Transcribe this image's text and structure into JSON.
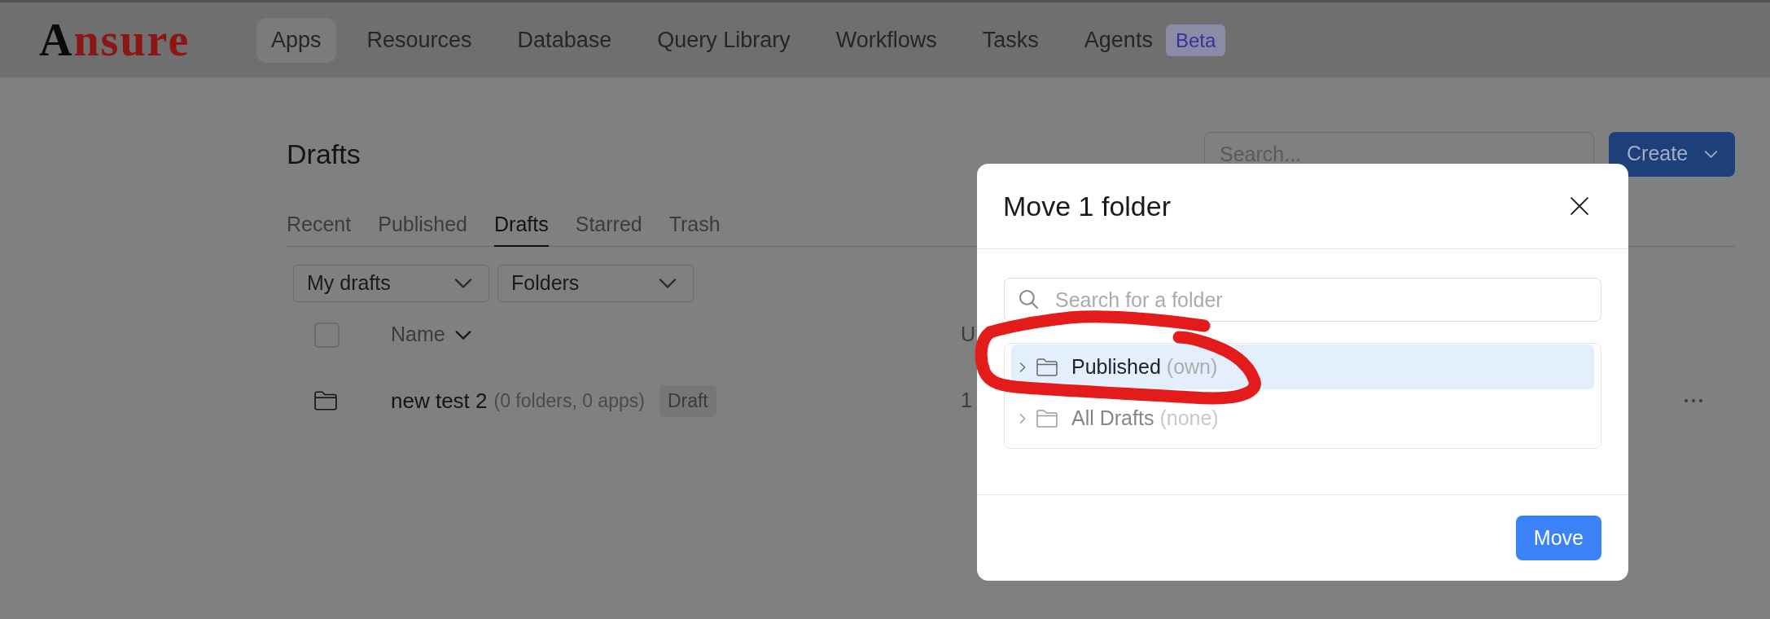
{
  "logo": {
    "initial": "A",
    "rest": "nsure"
  },
  "nav": [
    {
      "label": "Apps",
      "selected": true
    },
    {
      "label": "Resources",
      "selected": false
    },
    {
      "label": "Database",
      "selected": false
    },
    {
      "label": "Query Library",
      "selected": false
    },
    {
      "label": "Workflows",
      "selected": false
    },
    {
      "label": "Tasks",
      "selected": false
    },
    {
      "label": "Agents",
      "selected": false,
      "badge": "Beta"
    }
  ],
  "page": {
    "title": "Drafts",
    "search": {
      "placeholder": "Search..."
    },
    "create_button": "Create"
  },
  "tabs": [
    {
      "label": "Recent",
      "selected": false
    },
    {
      "label": "Published",
      "selected": false
    },
    {
      "label": "Drafts",
      "selected": true
    },
    {
      "label": "Starred",
      "selected": false
    },
    {
      "label": "Trash",
      "selected": false
    }
  ],
  "filters": [
    {
      "value": "My drafts"
    },
    {
      "value": "Folders"
    }
  ],
  "table": {
    "select_all": {
      "checked": false
    },
    "columns": [
      {
        "label": "Name"
      },
      {
        "label": "U"
      }
    ],
    "rows": [
      {
        "name": "new test 2",
        "summary": "(0 folders, 0 apps)",
        "badge": "Draft",
        "column_2": "1"
      }
    ]
  },
  "dialog": {
    "title": "Move 1 folder",
    "search": {
      "placeholder": "Search for a folder"
    },
    "folders": [
      {
        "name": "Published",
        "note": "(own)",
        "selected": true,
        "disabled": false,
        "expanded": false
      },
      {
        "name": "All Drafts",
        "note": "(none)",
        "selected": false,
        "disabled": true,
        "expanded": false
      }
    ],
    "buttons": [
      {
        "label": "Move",
        "kind": "primary"
      }
    ]
  }
}
